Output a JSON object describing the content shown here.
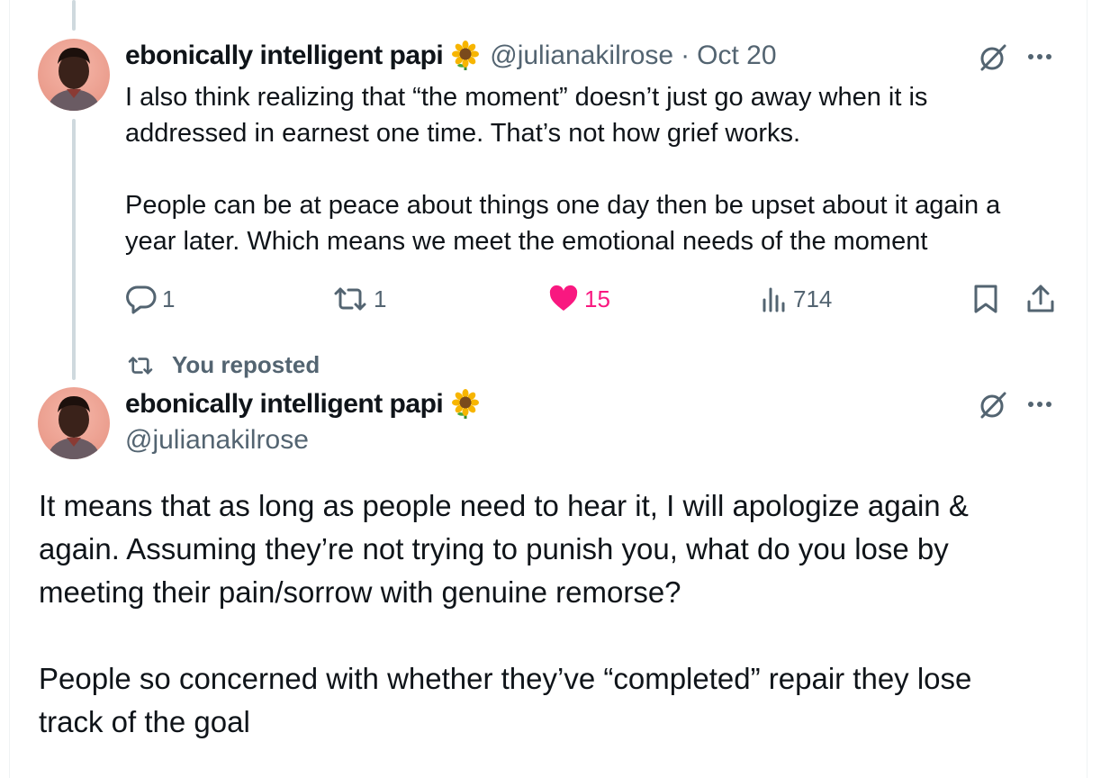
{
  "colors": {
    "text_primary": "#0f1419",
    "text_secondary": "#536471",
    "like_pink": "#f91880",
    "thread_line": "#cfd9de"
  },
  "tweet1": {
    "display_name": "ebonically intelligent papi",
    "badge_icon": "sunflower-icon",
    "handle": "@julianakilrose",
    "separator": "·",
    "date": "Oct 20",
    "text": "I also think realizing that “the moment” doesn’t just go away when it is\naddressed in earnest one time. That’s not how grief works.\n\nPeople can be at peace about things one day then be upset about it again a\nyear later. Which means we meet the emotional needs of the moment",
    "actions": {
      "replies": "1",
      "reposts": "1",
      "likes": "15",
      "views": "714"
    }
  },
  "repost_note": {
    "label": "You reposted"
  },
  "tweet2": {
    "display_name": "ebonically intelligent papi",
    "badge_icon": "sunflower-icon",
    "handle": "@julianakilrose",
    "text": "It means that as long as people need to hear it, I will apologize again &\nagain. Assuming they’re not trying to punish you, what do you lose by\nmeeting their pain/sorrow with genuine remorse?\n\nPeople so concerned with whether they’ve “completed” repair they lose\ntrack of the goal"
  }
}
